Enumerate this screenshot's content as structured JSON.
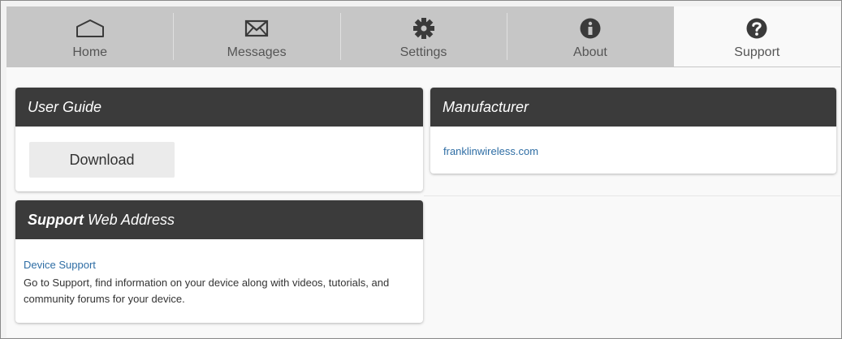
{
  "nav": {
    "tabs": [
      {
        "id": "home",
        "label": "Home",
        "icon": "home-icon"
      },
      {
        "id": "messages",
        "label": "Messages",
        "icon": "envelope-icon"
      },
      {
        "id": "settings",
        "label": "Settings",
        "icon": "gear-icon"
      },
      {
        "id": "about",
        "label": "About",
        "icon": "info-icon"
      },
      {
        "id": "support",
        "label": "Support",
        "icon": "question-icon",
        "active": true
      }
    ]
  },
  "user_guide": {
    "title": "User Guide",
    "download_label": "Download"
  },
  "manufacturer": {
    "title": "Manufacturer",
    "link_text": "franklinwireless.com"
  },
  "support_web": {
    "title_bold": "Support",
    "title_rest": " Web Address",
    "link_text": "Device Support",
    "description": "Go to Support, find information on your device along with videos, tutorials, and community forums for your device."
  },
  "colors": {
    "nav_bg": "#c6c6c6",
    "active_tab_bg": "#f9f9f9",
    "card_header_bg": "#3b3b3b",
    "link": "#2e6da4"
  }
}
